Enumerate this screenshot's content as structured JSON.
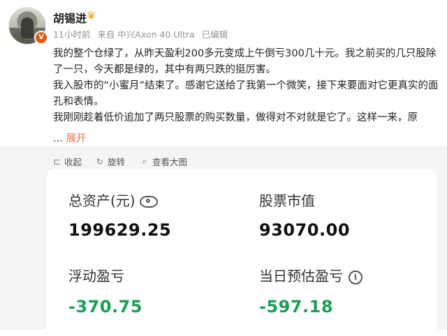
{
  "post": {
    "username": "胡锡进",
    "badge_icon": "crown-icon",
    "verified_icon": "v-verified-icon",
    "meta": {
      "time": "11小时前",
      "source": "来自 中兴Axon 40 Ultra",
      "edited": "已编辑"
    },
    "paragraphs": [
      "我的整个仓绿了，从昨天盈利200多元变成上午倒亏300几十元。我之前买的几只股除了一只，今天都是绿的，其中有两只跌的挺厉害。",
      "我入股市的“小蜜月”结束了。感谢它送给了我第一个微笑，接下来要面对它更真实的面孔和表情。",
      "我刚刚趁着低价追加了两只股票的购买数量，做得对不对就是它了。这样一来，原"
    ],
    "ellipsis": "...",
    "expand_label": "展开"
  },
  "actions": {
    "collapse_label": "收起",
    "rotate_label": "旋转",
    "view_large_label": "查看大图"
  },
  "account_card": {
    "total_assets_label": "总资产(元)",
    "total_assets_value": "199629.25",
    "stock_value_label": "股票市值",
    "stock_value_value": "93070.00",
    "floating_pl_label": "浮动盈亏",
    "floating_pl_value": "-370.75",
    "daily_pl_label": "当日预估盈亏",
    "daily_pl_value": "-597.18",
    "negative_color": "#1e9e54"
  }
}
